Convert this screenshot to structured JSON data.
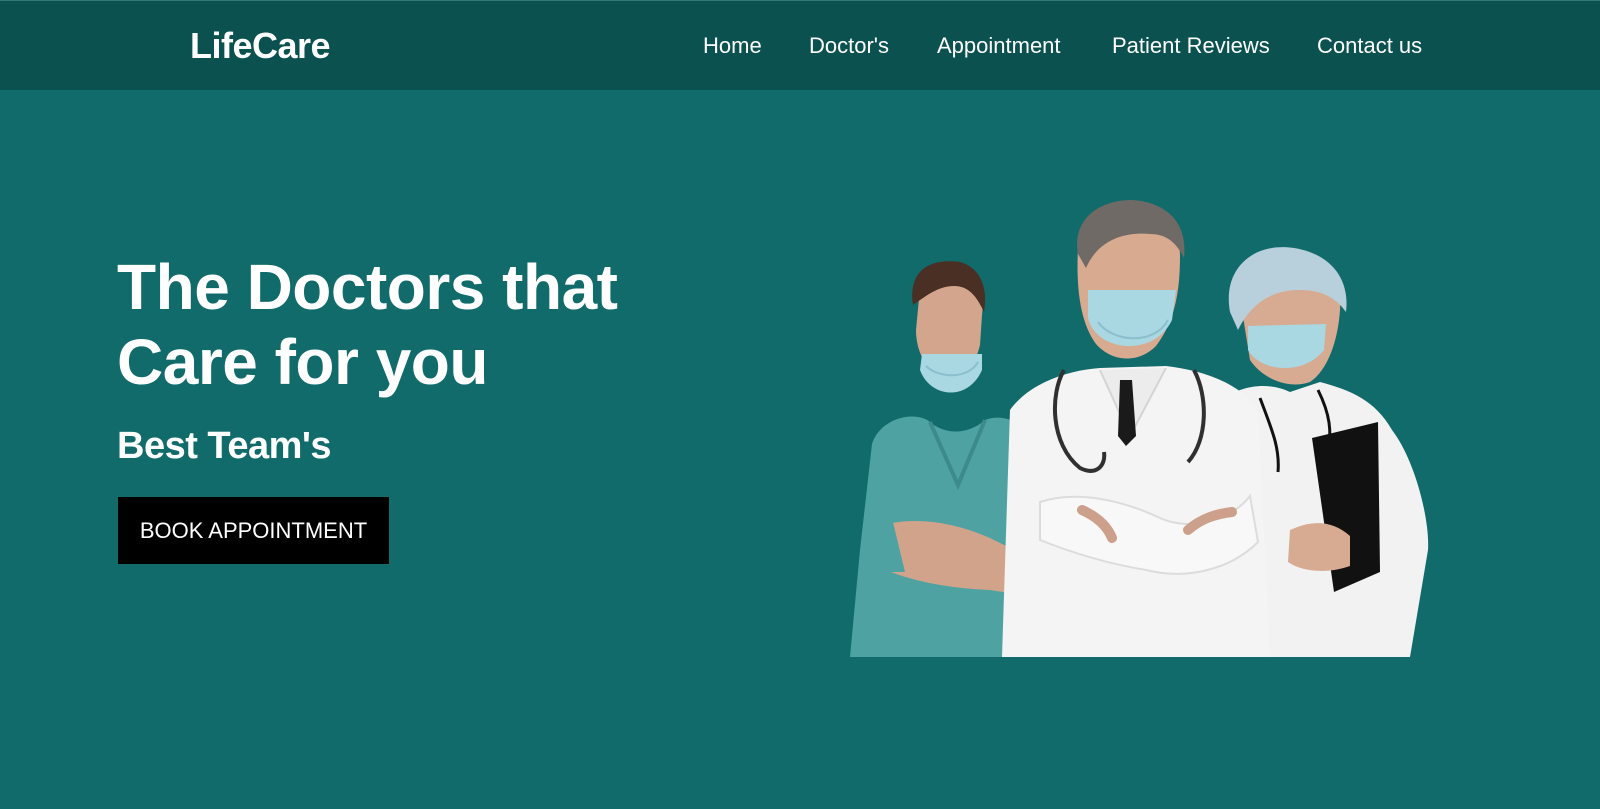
{
  "header": {
    "brand": "LifeCare",
    "nav": [
      {
        "label": "Home"
      },
      {
        "label": "Doctor's"
      },
      {
        "label": "Appointment"
      },
      {
        "label": "Patient Reviews"
      },
      {
        "label": "Contact us"
      }
    ]
  },
  "hero": {
    "title_line1": "The Doctors that",
    "title_line2": "Care for you",
    "subtitle": "Best Team's",
    "cta_label": "BOOK APPOINTMENT"
  },
  "colors": {
    "navbar_bg": "#0b5150",
    "hero_bg": "#116b6b",
    "cta_bg": "#000000",
    "text": "#ffffff"
  }
}
